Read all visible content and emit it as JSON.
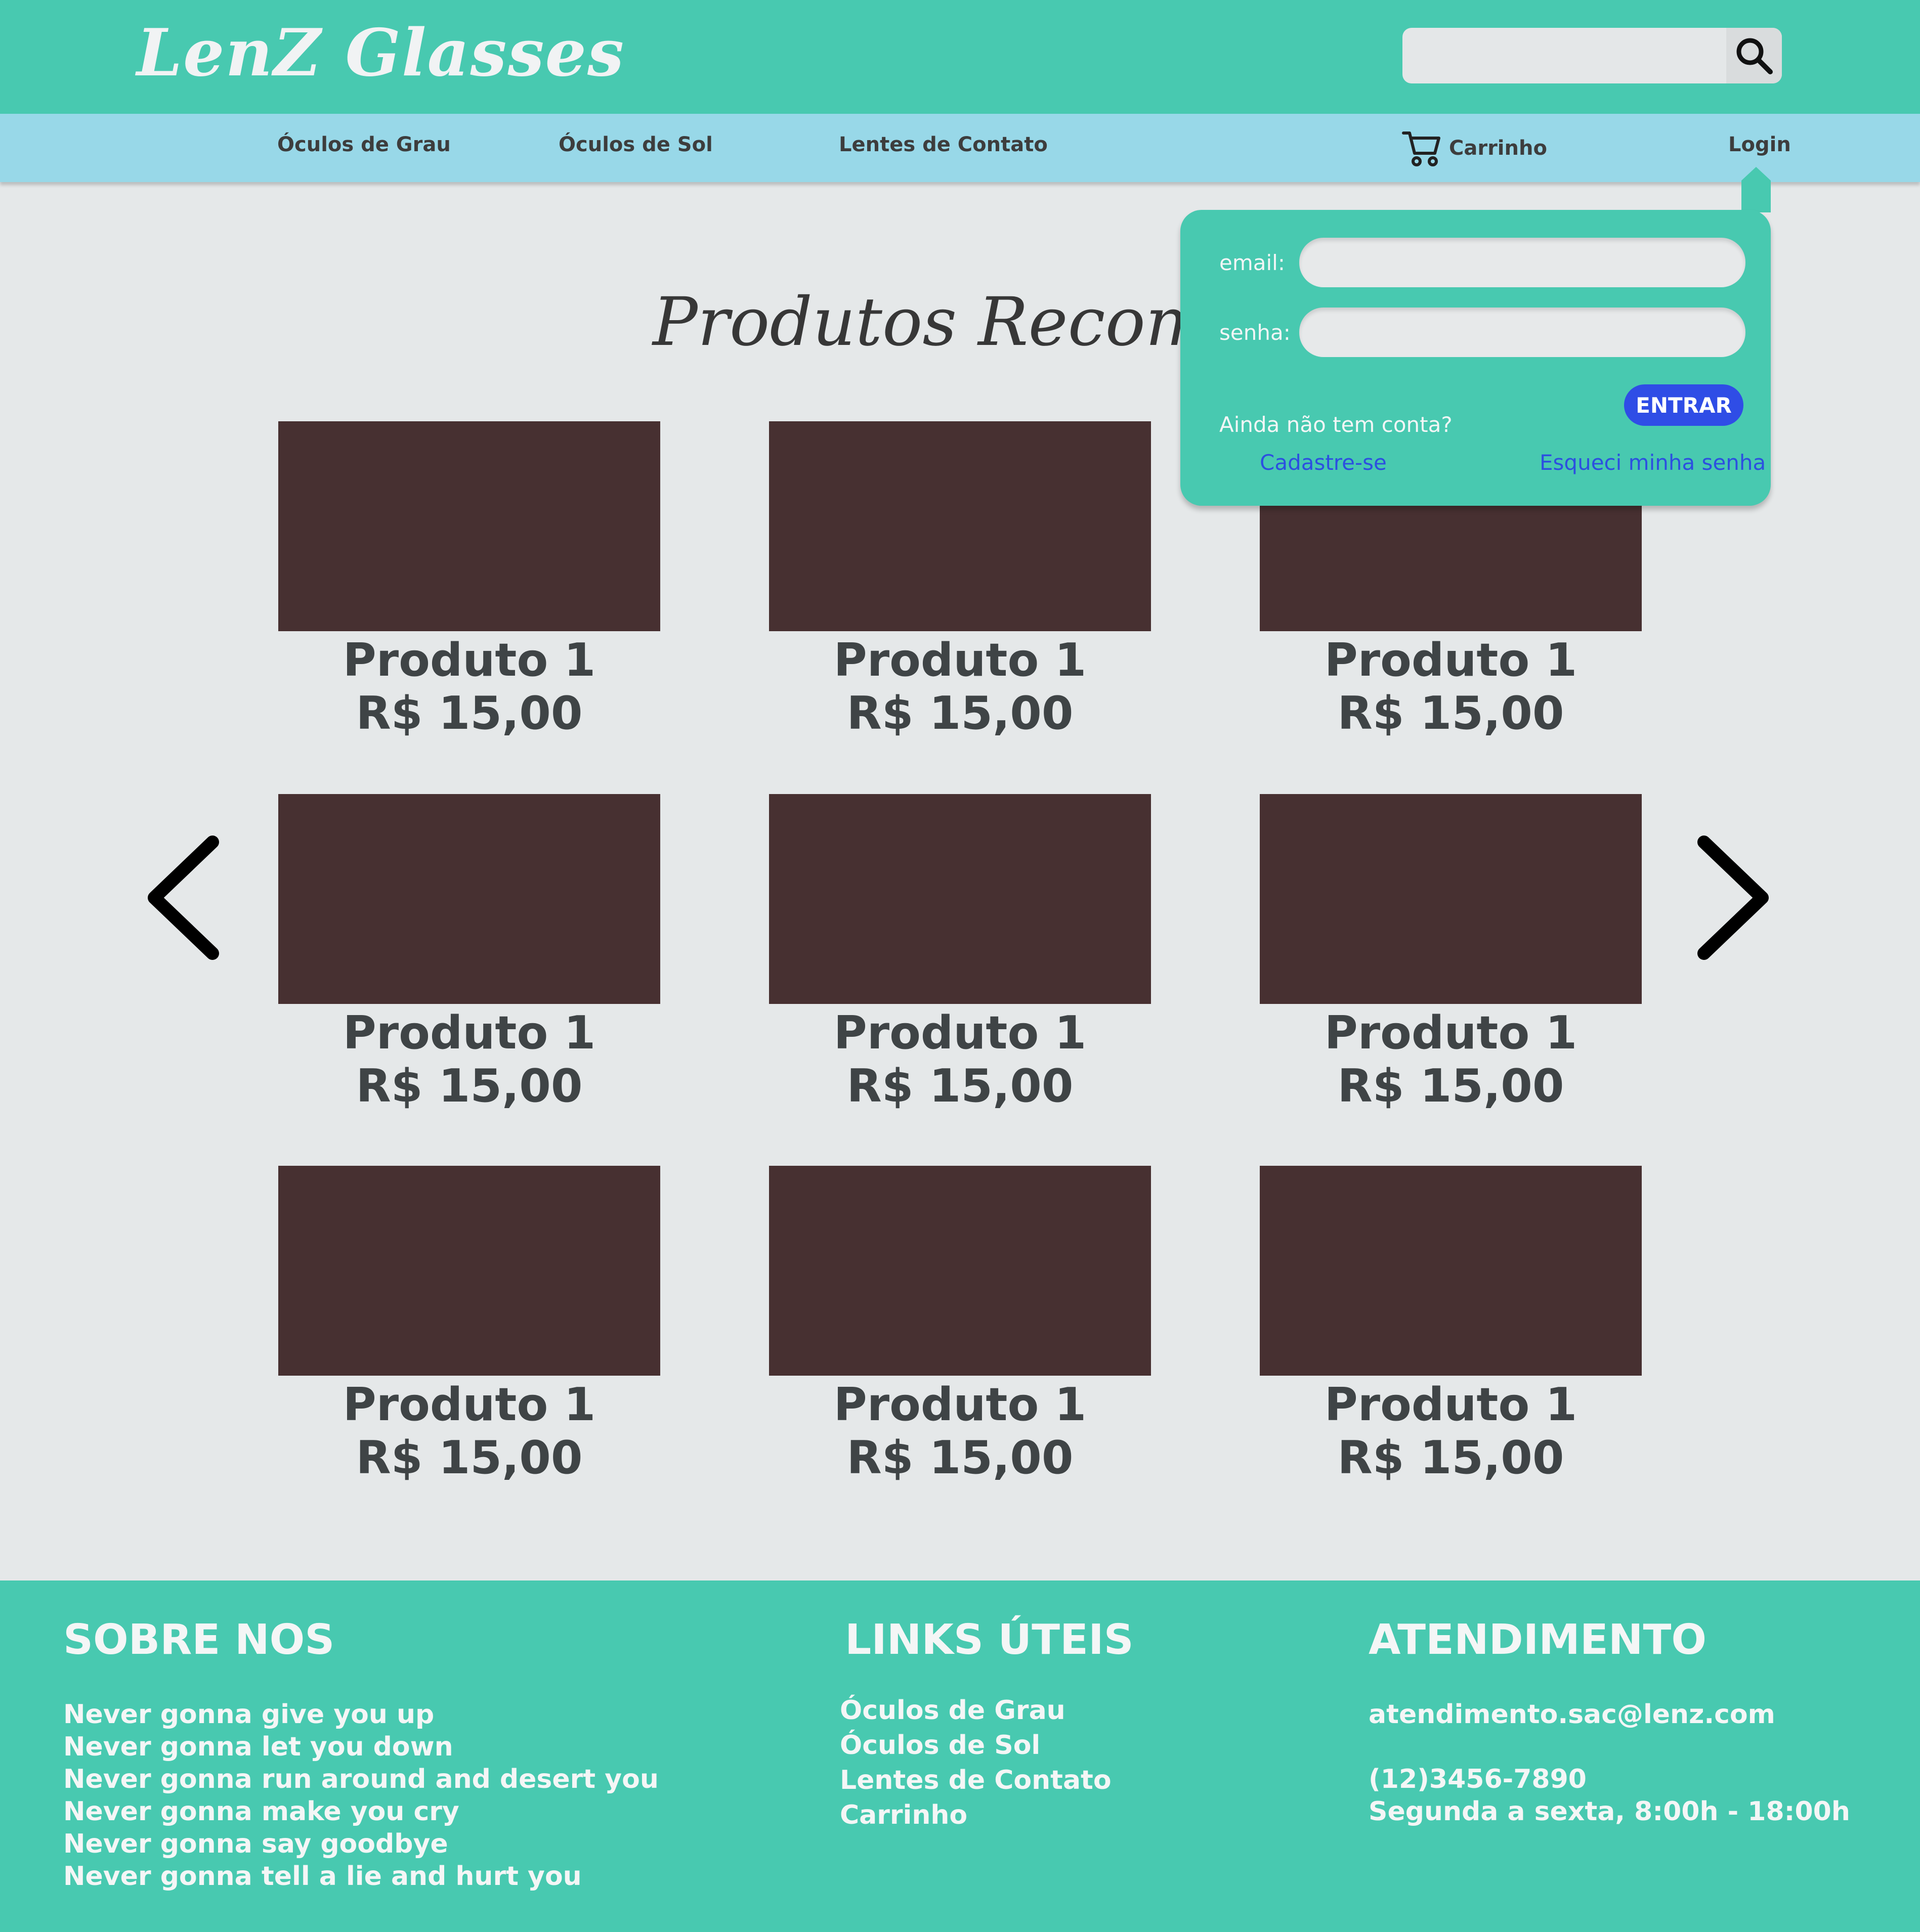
{
  "header": {
    "logo": "LenZ  Glasses",
    "search": {
      "placeholder": "",
      "icon": "search-icon"
    }
  },
  "nav": {
    "items": [
      "Óculos de Grau",
      "Óculos de Sol",
      "Lentes de Contato"
    ],
    "cart_label": "Carrinho",
    "cart_icon": "cart-icon",
    "login_label": "Login"
  },
  "main": {
    "heading": "Produtos Recomenda",
    "products": [
      {
        "name": "Produto 1",
        "price": "R$ 15,00"
      },
      {
        "name": "Produto 1",
        "price": "R$ 15,00"
      },
      {
        "name": "Produto 1",
        "price": "R$ 15,00"
      },
      {
        "name": "Produto 1",
        "price": "R$ 15,00"
      },
      {
        "name": "Produto 1",
        "price": "R$ 15,00"
      },
      {
        "name": "Produto 1",
        "price": "R$ 15,00"
      },
      {
        "name": "Produto 1",
        "price": "R$ 15,00"
      },
      {
        "name": "Produto 1",
        "price": "R$ 15,00"
      },
      {
        "name": "Produto 1",
        "price": "R$ 15,00"
      }
    ],
    "prev_icon": "chevron-left-icon",
    "next_icon": "chevron-right-icon"
  },
  "login_popup": {
    "email_label": "email:",
    "email_value": "",
    "password_label": "senha:",
    "password_value": "",
    "enter_label": "ENTRAR",
    "no_account": "Ainda não tem conta?",
    "signup_link": "Cadastre-se",
    "forgot_link": "Esqueci minha senha"
  },
  "footer": {
    "about_title": "SOBRE NOS",
    "about_lines": [
      "Never gonna give you up",
      "Never gonna let you down",
      "Never gonna run around and desert you",
      "Never gonna make you cry",
      "Never gonna say goodbye",
      "Never gonna tell a lie and hurt you"
    ],
    "links_title": "LINKS ÚTEIS",
    "links": [
      "Óculos de Grau",
      "Óculos de Sol",
      "Lentes de Contato",
      "Carrinho"
    ],
    "service_title": "ATENDIMENTO",
    "service_email": "atendimento.sac@lenz.com",
    "service_phone": "(12)3456-7890",
    "service_hours": "Segunda a sexta, 8:00h - 18:00h"
  },
  "colors": {
    "primary": "#48c9b0",
    "navbar": "#98d8e8",
    "background": "#e5e8e9",
    "product_image": "#473031",
    "button": "#2f4de6",
    "link": "#2c4fe0"
  }
}
